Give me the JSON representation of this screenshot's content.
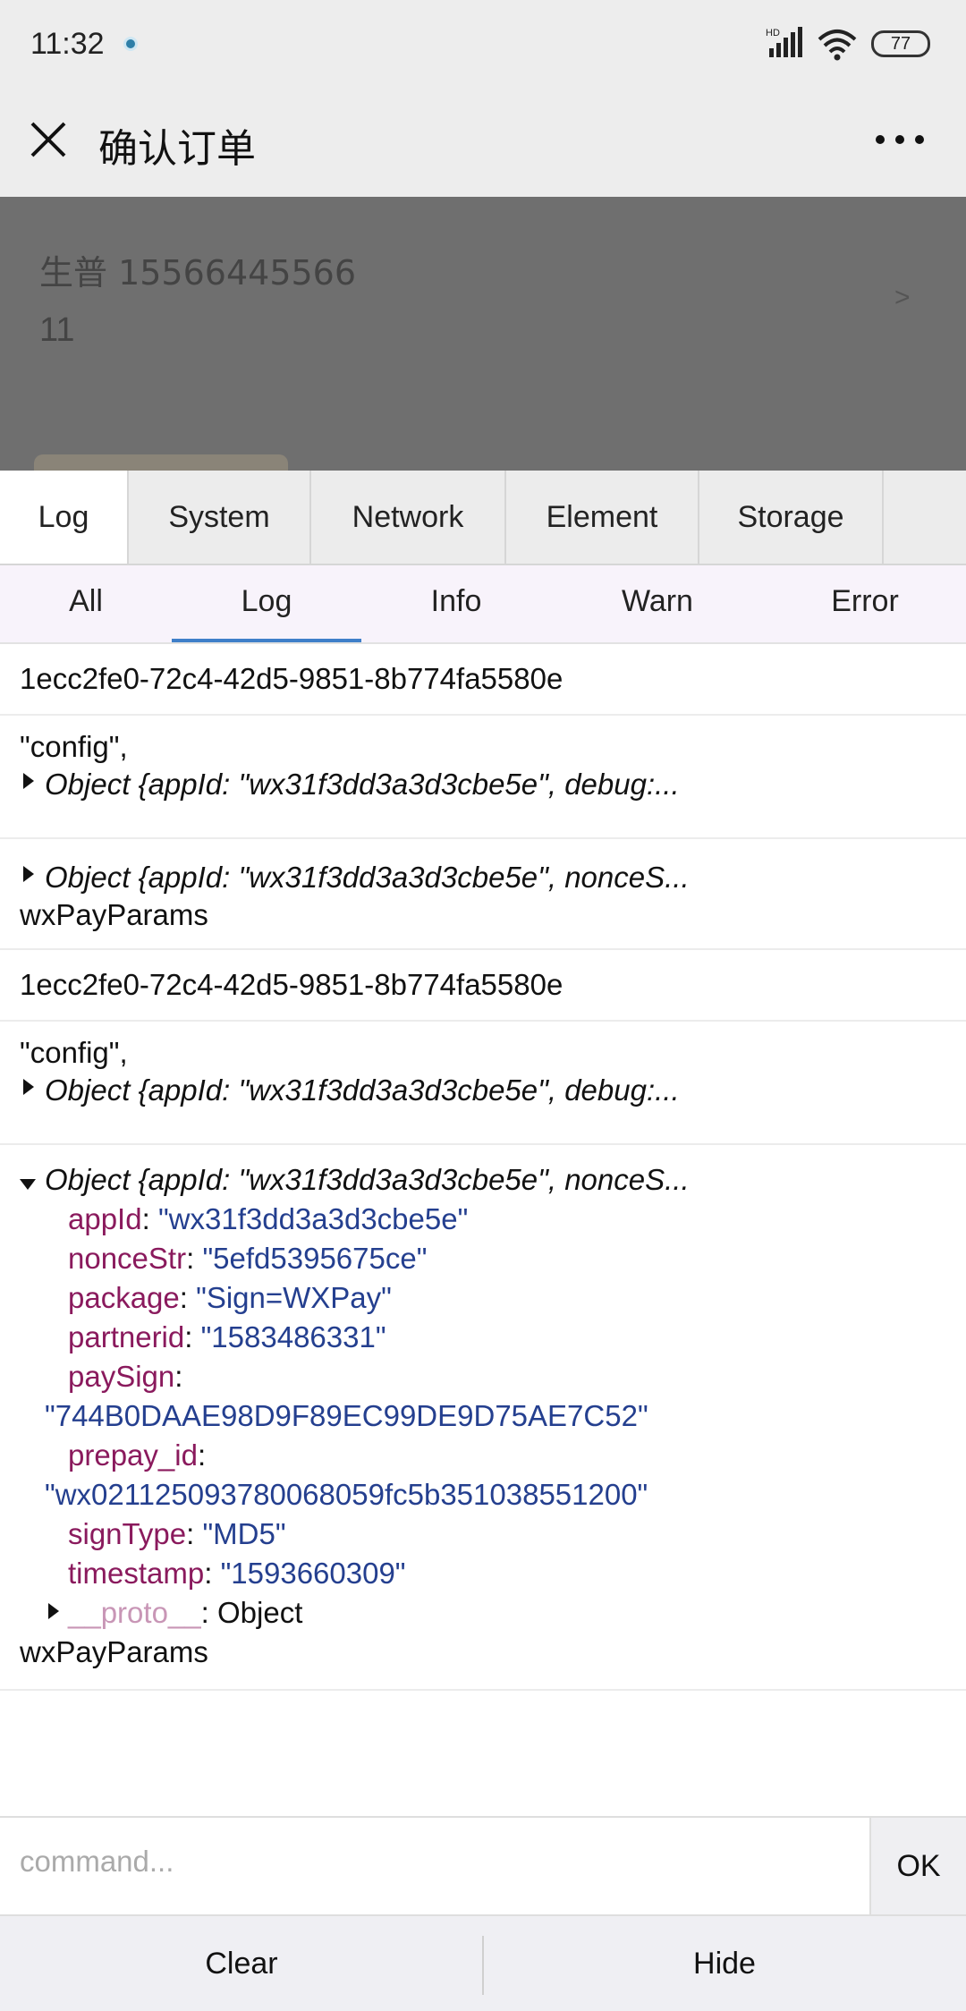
{
  "status_bar": {
    "time": "11:32",
    "network": "HD",
    "battery": "77"
  },
  "header": {
    "title": "确认订单"
  },
  "background_page": {
    "address_line": "生普 15566445566",
    "detail_line": "11",
    "chevron": ">"
  },
  "console": {
    "tabs": [
      "Log",
      "System",
      "Network",
      "Element",
      "Storage"
    ],
    "active_tab": "Log",
    "filters": [
      "All",
      "Log",
      "Info",
      "Warn",
      "Error"
    ],
    "active_filter": "Log",
    "entries": {
      "e1": {
        "text": "1ecc2fe0-72c4-42d5-9851-8b774fa5580e"
      },
      "e2": {
        "label": "\"config\",",
        "object": "Object {appId: \"wx31f3dd3a3d3cbe5e\", debug:..."
      },
      "e3": {
        "object": "Object {appId: \"wx31f3dd3a3d3cbe5e\", nonceS...",
        "text": "wxPayParams"
      },
      "e4": {
        "text": "1ecc2fe0-72c4-42d5-9851-8b774fa5580e"
      },
      "e5": {
        "label": "\"config\",",
        "object": "Object {appId: \"wx31f3dd3a3d3cbe5e\", debug:..."
      },
      "e6": {
        "object": "Object {appId: \"wx31f3dd3a3d3cbe5e\", nonceS...",
        "props": {
          "appId": {
            "key": "appId",
            "value": "\"wx31f3dd3a3d3cbe5e\""
          },
          "nonceStr": {
            "key": "nonceStr",
            "value": "\"5efd5395675ce\""
          },
          "package": {
            "key": "package",
            "value": "\"Sign=WXPay\""
          },
          "partnerid": {
            "key": "partnerid",
            "value": "\"1583486331\""
          },
          "paySign": {
            "key": "paySign",
            "value": "\"744B0DAAE98D9F89EC99DE9D75AE7C52\""
          },
          "prepay_id": {
            "key": "prepay_id",
            "value": "\"wx021125093780068059fc5b351038551200\""
          },
          "signType": {
            "key": "signType",
            "value": "\"MD5\""
          },
          "timestamp": {
            "key": "timestamp",
            "value": "\"1593660309\""
          }
        },
        "proto_key": "__proto__",
        "proto_value": "Object",
        "text": "wxPayParams"
      }
    },
    "command_placeholder": "command...",
    "ok_label": "OK",
    "clear_label": "Clear",
    "hide_label": "Hide",
    "colors": {
      "key": "#8a1a5d",
      "value": "#243f8f",
      "accent": "#3f7fc9"
    }
  }
}
